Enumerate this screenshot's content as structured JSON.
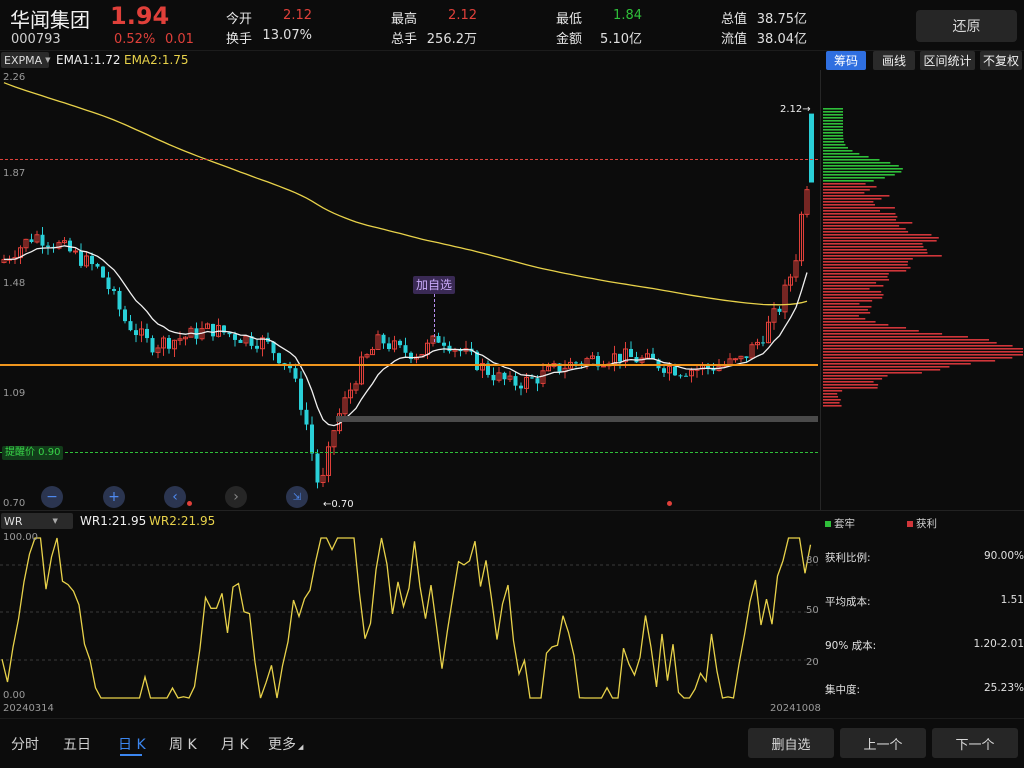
{
  "header": {
    "name": "华闻集团",
    "price": "1.94",
    "code": "000793",
    "change_pct": "0.52%",
    "change_amt": "0.01",
    "stats": [
      {
        "label": "今开",
        "value": "2.12",
        "color": "red"
      },
      {
        "label": "换手",
        "value": "13.07%",
        "color": "white"
      },
      {
        "label": "最高",
        "value": "2.12",
        "color": "red"
      },
      {
        "label": "总手",
        "value": "256.2万",
        "color": "white"
      },
      {
        "label": "最低",
        "value": "1.84",
        "color": "green"
      },
      {
        "label": "金额",
        "value": "5.10亿",
        "color": "white"
      },
      {
        "label": "总值",
        "value": "38.75亿",
        "color": "white"
      },
      {
        "label": "流值",
        "value": "38.04亿",
        "color": "white"
      }
    ],
    "restore_button": "还原"
  },
  "main_indicator": {
    "name": "EXPMA",
    "ema1": "EMA1:1.72",
    "ema2": "EMA2:1.75"
  },
  "tools": {
    "chips": "筹码",
    "draw": "画线",
    "range": "区间统计",
    "adjust": "不复权"
  },
  "price_axis": [
    "2.26",
    "1.87",
    "1.48",
    "1.09",
    "0.70"
  ],
  "annotations": {
    "high": "2.12",
    "low": "0.70",
    "alert": "提醒价 0.90",
    "watch": "加自选"
  },
  "sub_indicator": {
    "name": "WR",
    "wr1": "WR1:21.95",
    "wr2": "WR2:21.95",
    "axis": [
      "100.00",
      "0.00"
    ],
    "right_axis": [
      "80",
      "50",
      "20"
    ],
    "date_start": "20240314",
    "date_end": "20241008"
  },
  "chip": {
    "legend_loss": "套牢",
    "legend_profit": "获利",
    "rows": [
      {
        "label": "获利比例:",
        "value": "90.00%"
      },
      {
        "label": "平均成本:",
        "value": "1.51"
      },
      {
        "label": "90% 成本:",
        "value": "1.20-2.01"
      },
      {
        "label": "集中度:",
        "value": "25.23%"
      }
    ]
  },
  "bottom": {
    "tabs": [
      "分时",
      "五日",
      "日 K",
      "周 K",
      "月 K",
      "更多"
    ],
    "active_tab": 2,
    "buttons": [
      "删自选",
      "上一个",
      "下一个"
    ]
  },
  "colors": {
    "up": "#e0403a",
    "down": "#2ad0d8",
    "ema1": "#f0f0f0",
    "ema2": "#e8d24a",
    "chip_profit": "#d0363a",
    "chip_loss": "#2fbf3a",
    "alert": "#2fbf3a",
    "support": "#f0961e"
  },
  "chart_data": {
    "type": "candlestick",
    "y_range": [
      0.7,
      2.26
    ],
    "date_range": [
      "20240314",
      "20241008"
    ],
    "last_close": 1.94,
    "high": 2.12,
    "low": 0.7,
    "alert_price": 0.9,
    "support_level": 1.2,
    "wr": {
      "y_range": [
        0,
        100
      ],
      "last": 21.95
    }
  }
}
